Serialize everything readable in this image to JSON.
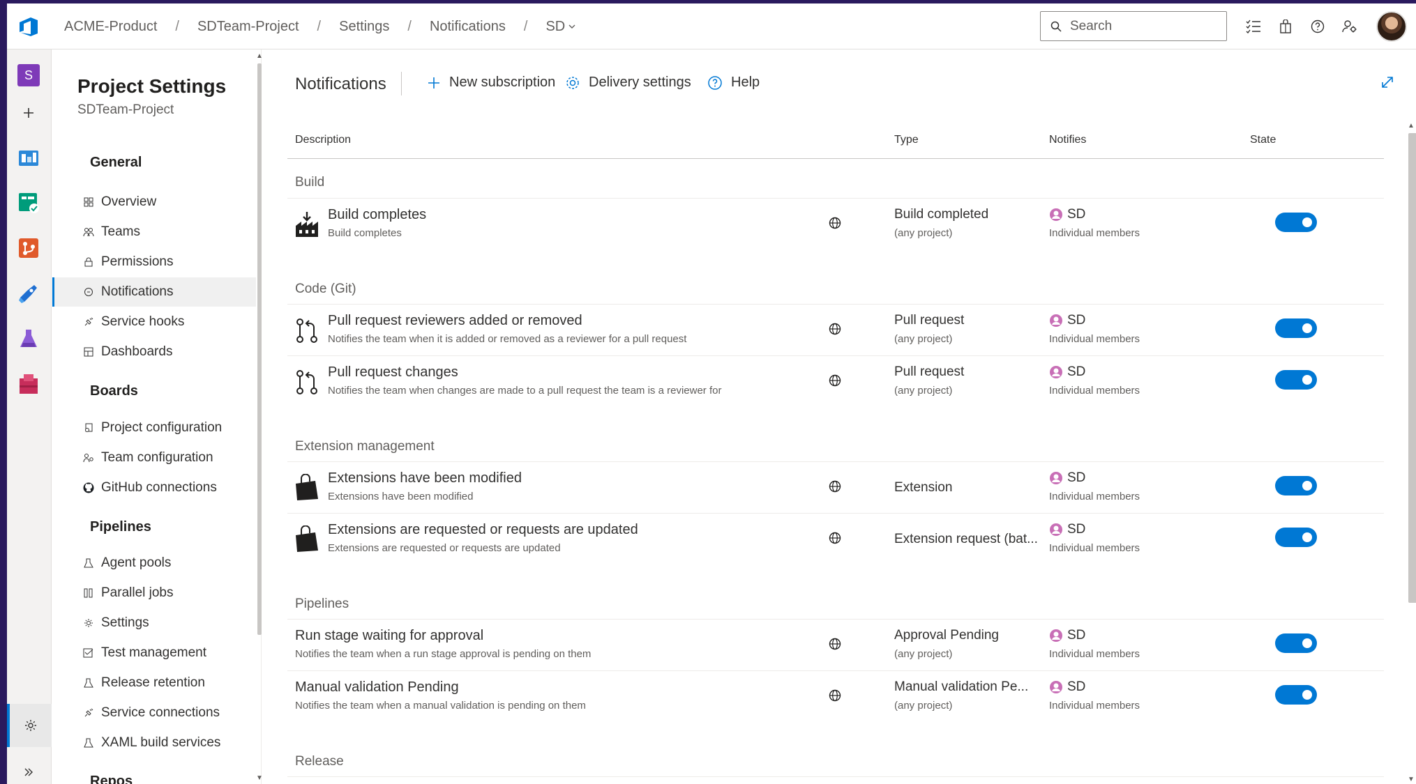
{
  "breadcrumb": {
    "items": [
      "ACME-Product",
      "SDTeam-Project",
      "Settings",
      "Notifications"
    ],
    "current": "SD"
  },
  "search": {
    "placeholder": "Search"
  },
  "nav": {
    "title": "Project Settings",
    "subtitle": "SDTeam-Project",
    "sections": {
      "general": "General",
      "boards": "Boards",
      "pipelines": "Pipelines",
      "repos": "Repos"
    },
    "general_items": [
      "Overview",
      "Teams",
      "Permissions",
      "Notifications",
      "Service hooks",
      "Dashboards"
    ],
    "boards_items": [
      "Project configuration",
      "Team configuration",
      "GitHub connections"
    ],
    "pipelines_items": [
      "Agent pools",
      "Parallel jobs",
      "Settings",
      "Test management",
      "Release retention",
      "Service connections",
      "XAML build services"
    ]
  },
  "commandbar": {
    "title": "Notifications",
    "new_subscription": "New subscription",
    "delivery_settings": "Delivery settings",
    "help": "Help"
  },
  "table": {
    "headers": {
      "description": "Description",
      "type": "Type",
      "notifies": "Notifies",
      "state": "State"
    },
    "groups": [
      "Build",
      "Code (Git)",
      "Extension management",
      "Pipelines",
      "Release"
    ],
    "rows": [
      {
        "title": "Build completes",
        "desc": "Build completes",
        "type": "Build completed",
        "type_sub": "(any project)",
        "notifies": "SD",
        "notifies_sub": "Individual members",
        "state": "on"
      },
      {
        "title": "Pull request reviewers added or removed",
        "desc": "Notifies the team when it is added or removed as a reviewer for a pull request",
        "type": "Pull request",
        "type_sub": "(any project)",
        "notifies": "SD",
        "notifies_sub": "Individual members",
        "state": "on"
      },
      {
        "title": "Pull request changes",
        "desc": "Notifies the team when changes are made to a pull request the team is a reviewer for",
        "type": "Pull request",
        "type_sub": "(any project)",
        "notifies": "SD",
        "notifies_sub": "Individual members",
        "state": "on"
      },
      {
        "title": "Extensions have been modified",
        "desc": "Extensions have been modified",
        "type": "Extension",
        "type_sub": "",
        "notifies": "SD",
        "notifies_sub": "Individual members",
        "state": "on"
      },
      {
        "title": "Extensions are requested or requests are updated",
        "desc": "Extensions are requested or requests are updated",
        "type": "Extension request (bat...",
        "type_sub": "",
        "notifies": "SD",
        "notifies_sub": "Individual members",
        "state": "on"
      },
      {
        "title": "Run stage waiting for approval",
        "desc": "Notifies the team when a run stage approval is pending on them",
        "type": "Approval Pending",
        "type_sub": "(any project)",
        "notifies": "SD",
        "notifies_sub": "Individual members",
        "state": "on"
      },
      {
        "title": "Manual validation Pending",
        "desc": "Notifies the team when a manual validation is pending on them",
        "type": "Manual validation Pe...",
        "type_sub": "(any project)",
        "notifies": "SD",
        "notifies_sub": "Individual members",
        "state": "on"
      }
    ]
  },
  "colors": {
    "accent": "#0078d4",
    "project_badge": "#7e3ab8"
  }
}
